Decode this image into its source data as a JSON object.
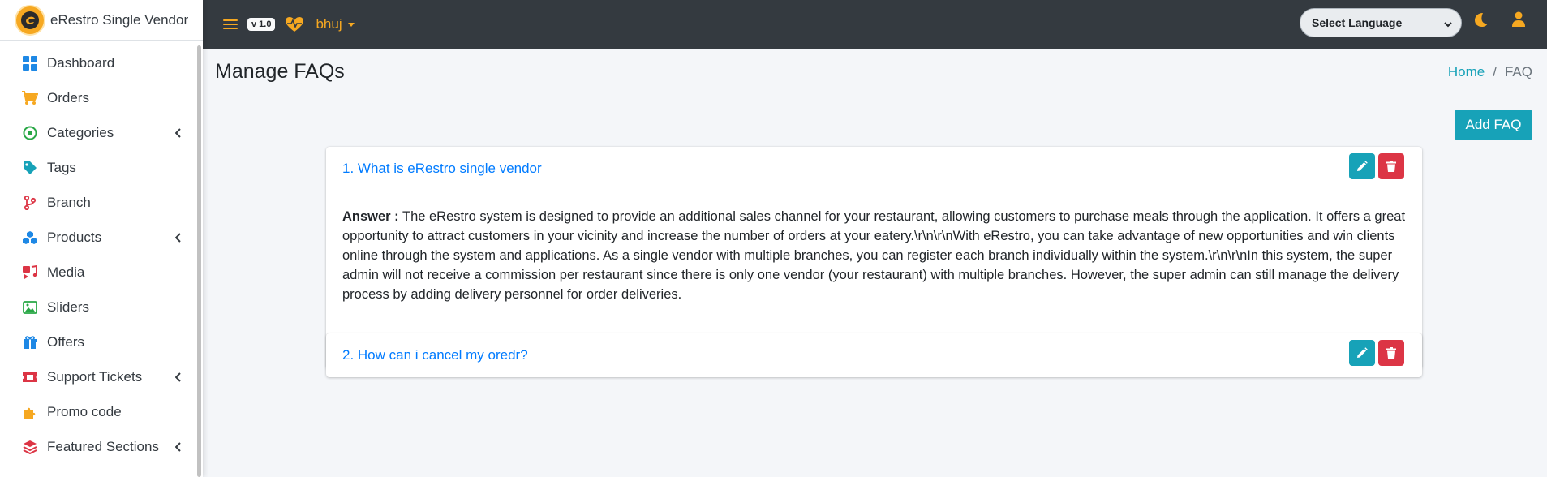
{
  "brand": {
    "name": "eRestro Single Vendor"
  },
  "sidebar": {
    "items": [
      {
        "label": "Dashboard",
        "icon": "dashboard-icon",
        "color": "#1e88e5",
        "has_caret": false
      },
      {
        "label": "Orders",
        "icon": "cart-icon",
        "color": "#f6a821",
        "has_caret": false
      },
      {
        "label": "Categories",
        "icon": "target-icon",
        "color": "#28a745",
        "has_caret": true
      },
      {
        "label": "Tags",
        "icon": "tag-icon",
        "color": "#17a2b8",
        "has_caret": false
      },
      {
        "label": "Branch",
        "icon": "branch-icon",
        "color": "#dc3545",
        "has_caret": false
      },
      {
        "label": "Products",
        "icon": "cubes-icon",
        "color": "#1e88e5",
        "has_caret": true
      },
      {
        "label": "Media",
        "icon": "media-icon",
        "color": "#dc3545",
        "has_caret": false
      },
      {
        "label": "Sliders",
        "icon": "image-icon",
        "color": "#28a745",
        "has_caret": false
      },
      {
        "label": "Offers",
        "icon": "gift-icon",
        "color": "#1e88e5",
        "has_caret": false
      },
      {
        "label": "Support Tickets",
        "icon": "ticket-icon",
        "color": "#dc3545",
        "has_caret": true
      },
      {
        "label": "Promo code",
        "icon": "puzzle-icon",
        "color": "#f6a821",
        "has_caret": false
      },
      {
        "label": "Featured Sections",
        "icon": "layers-icon",
        "color": "#dc3545",
        "has_caret": true
      }
    ]
  },
  "topbar": {
    "version": "v 1.0",
    "branch": "bhuj",
    "language_select": "Select Language",
    "accent": "#f6a821"
  },
  "page": {
    "title": "Manage FAQs",
    "breadcrumb": {
      "home": "Home",
      "separator": "/",
      "current": "FAQ"
    },
    "add_button": "Add FAQ"
  },
  "faqs": [
    {
      "question": "1. What is eRestro single vendor",
      "answer_label": "Answer :",
      "answer": "The eRestro system is designed to provide an additional sales channel for your restaurant, allowing customers to purchase meals through the application. It offers a great opportunity to attract customers in your vicinity and increase the number of orders at your eatery.\\r\\n\\r\\nWith eRestro, you can take advantage of new opportunities and win clients online through the system and applications. As a single vendor with multiple branches, you can register each branch individually within the system.\\r\\n\\r\\nIn this system, the super admin will not receive a commission per restaurant since there is only one vendor (your restaurant) with multiple branches. However, the super admin can still manage the delivery process by adding delivery personnel for order deliveries."
    },
    {
      "question": "2. How can i cancel my oredr?"
    }
  ]
}
